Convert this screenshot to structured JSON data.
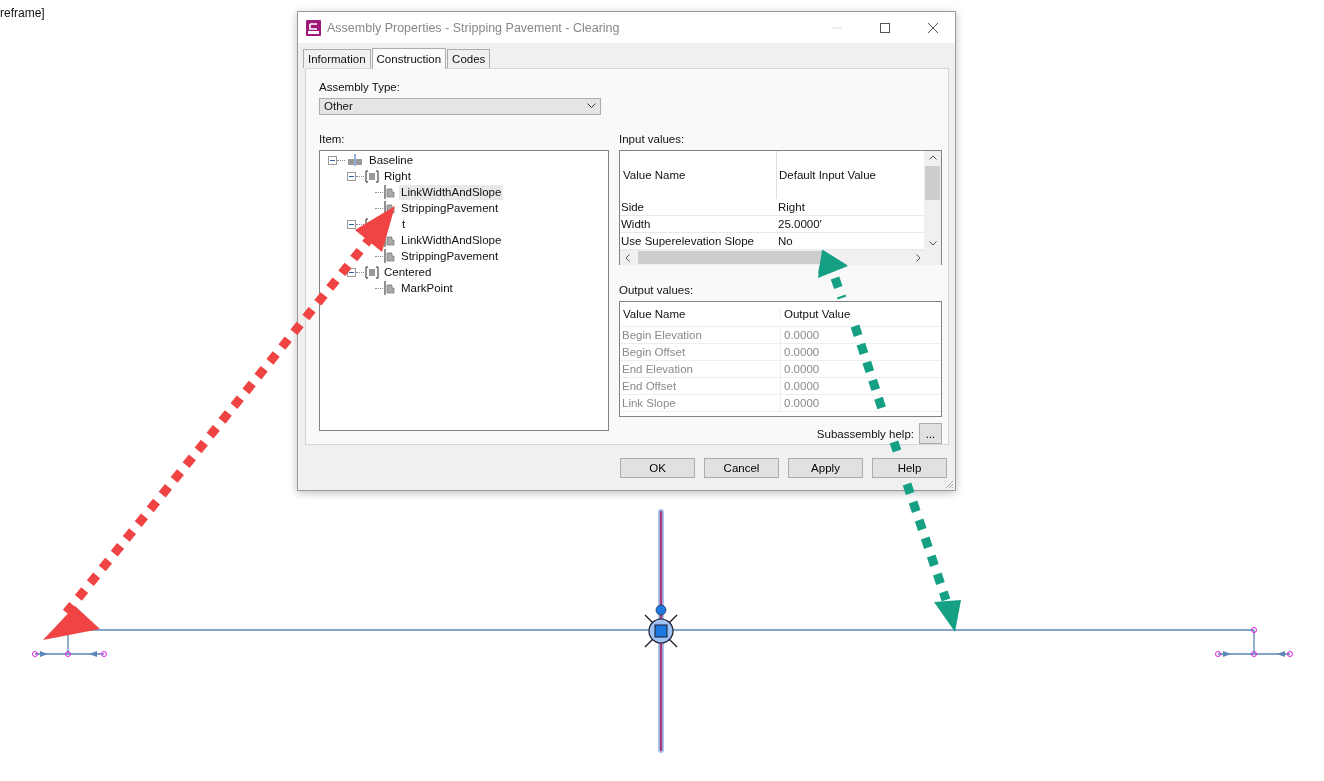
{
  "canvas_label": "reframe]",
  "window": {
    "title": "Assembly Properties - Stripping Pavement - Clearing"
  },
  "tabs": [
    {
      "label": "Information",
      "selected": false
    },
    {
      "label": "Construction",
      "selected": true
    },
    {
      "label": "Codes",
      "selected": false
    }
  ],
  "assembly_type": {
    "label": "Assembly Type:",
    "value": "Other"
  },
  "item_tree": {
    "label": "Item:",
    "nodes": [
      {
        "label": "Baseline",
        "kind": "baseline",
        "expanded": true,
        "selected": false,
        "children": [
          {
            "label": "Right",
            "kind": "group",
            "expanded": true,
            "selected": false,
            "children": [
              {
                "label": "LinkWidthAndSlope",
                "kind": "subassembly",
                "selected": true
              },
              {
                "label": "StrippingPavement",
                "kind": "subassembly",
                "selected": false
              }
            ]
          },
          {
            "label": "t",
            "kind": "group",
            "expanded": true,
            "selected": false,
            "children": [
              {
                "label": "LinkWidthAndSlope",
                "kind": "subassembly",
                "selected": false
              },
              {
                "label": "StrippingPavement",
                "kind": "subassembly",
                "selected": false
              }
            ]
          },
          {
            "label": "Centered",
            "kind": "group",
            "expanded": true,
            "selected": false,
            "children": [
              {
                "label": "MarkPoint",
                "kind": "subassembly",
                "selected": false
              }
            ]
          }
        ]
      }
    ]
  },
  "input_values": {
    "label": "Input values:",
    "columns": [
      "Value Name",
      "Default Input Value"
    ],
    "rows": [
      {
        "name": "Side",
        "value": "Right",
        "disabled": false
      },
      {
        "name": "Width",
        "value": "25.0000'",
        "disabled": false
      },
      {
        "name": "Use Superelevation Slope",
        "value": "No",
        "disabled": false
      }
    ]
  },
  "output_values": {
    "label": "Output values:",
    "columns": [
      "Value Name",
      "Output Value"
    ],
    "rows": [
      {
        "name": "Begin Elevation",
        "value": "0.0000",
        "disabled": true
      },
      {
        "name": "Begin Offset",
        "value": "0.0000",
        "disabled": true
      },
      {
        "name": "End Elevation",
        "value": "0.0000",
        "disabled": true
      },
      {
        "name": "End Offset",
        "value": "0.0000",
        "disabled": true
      },
      {
        "name": "Link Slope",
        "value": "0.0000",
        "disabled": true
      }
    ]
  },
  "subassembly_help": {
    "label": "Subassembly help:",
    "button": "..."
  },
  "buttons": [
    "OK",
    "Cancel",
    "Apply",
    "Help"
  ]
}
